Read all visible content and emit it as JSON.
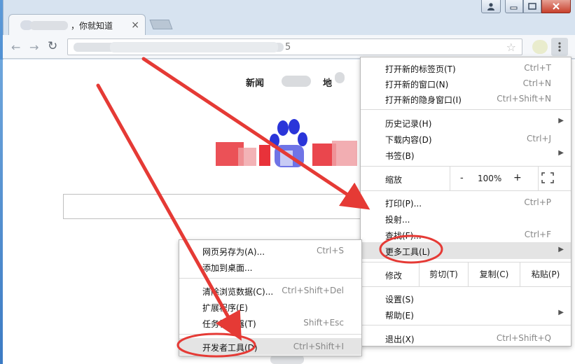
{
  "tab": {
    "title": "，你就知道",
    "close": "×"
  },
  "toolbar": {
    "url_suffix": "5"
  },
  "page": {
    "news": "新闻",
    "map": "地"
  },
  "menu": {
    "items_top": [
      {
        "label": "打开新的标签页(T)",
        "shortcut": "Ctrl+T"
      },
      {
        "label": "打开新的窗口(N)",
        "shortcut": "Ctrl+N"
      },
      {
        "label": "打开新的隐身窗口(I)",
        "shortcut": "Ctrl+Shift+N"
      }
    ],
    "items_mid": [
      {
        "label": "历史记录(H)",
        "shortcut": ""
      },
      {
        "label": "下载内容(D)",
        "shortcut": "Ctrl+J"
      },
      {
        "label": "书签(B)",
        "shortcut": ""
      }
    ],
    "zoom": {
      "label": "缩放",
      "minus": "-",
      "value": "100%",
      "plus": "+"
    },
    "items_print": [
      {
        "label": "打印(P)...",
        "shortcut": "Ctrl+P"
      },
      {
        "label": "投射...",
        "shortcut": ""
      },
      {
        "label": "查找(F)...",
        "shortcut": "Ctrl+F"
      },
      {
        "label": "更多工具(L)",
        "shortcut": ""
      }
    ],
    "edit": {
      "label": "修改",
      "cut": "剪切(T)",
      "copy": "复制(C)",
      "paste": "粘贴(P)"
    },
    "items_settings": [
      {
        "label": "设置(S)",
        "shortcut": ""
      },
      {
        "label": "帮助(E)",
        "shortcut": ""
      }
    ],
    "exit": {
      "label": "退出(X)",
      "shortcut": "Ctrl+Shift+Q"
    }
  },
  "submenu": {
    "items": [
      {
        "label": "网页另存为(A)...",
        "shortcut": "Ctrl+S"
      },
      {
        "label": "添加到桌面...",
        "shortcut": ""
      },
      {
        "label": "清除浏览数据(C)...",
        "shortcut": "Ctrl+Shift+Del"
      },
      {
        "label": "扩展程序(E)",
        "shortcut": ""
      },
      {
        "label": "任务管理器(T)",
        "shortcut": "Shift+Esc"
      },
      {
        "label": "开发者工具(D)",
        "shortcut": "Ctrl+Shift+I"
      }
    ]
  },
  "colors": {
    "annotation_red": "#e53a35",
    "menu_highlight": "#e4e4e4"
  },
  "icons": [
    "user-icon",
    "minimize-icon",
    "maximize-icon",
    "close-icon",
    "back-icon",
    "forward-icon",
    "reload-icon",
    "star-icon",
    "menu-dots-icon",
    "fullscreen-icon",
    "submenu-arrow-icon"
  ]
}
